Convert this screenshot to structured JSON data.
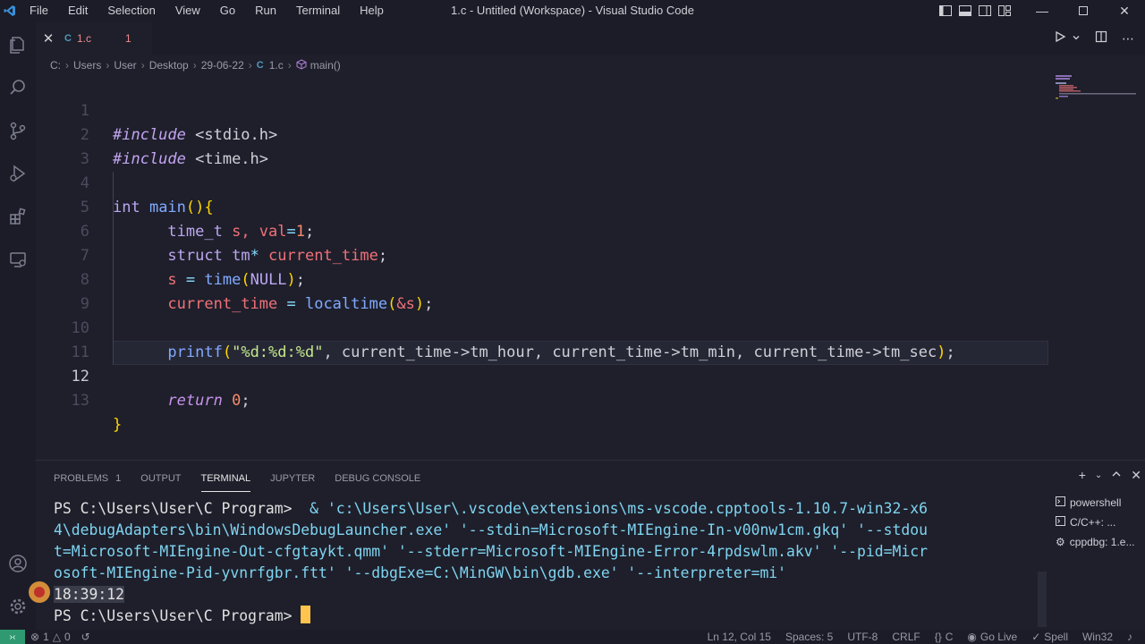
{
  "titlebar": {
    "menu": [
      "File",
      "Edit",
      "Selection",
      "View",
      "Go",
      "Run",
      "Terminal",
      "Help"
    ],
    "title": "1.c - Untitled (Workspace) - Visual Studio Code"
  },
  "tab": {
    "close": "✕",
    "lang": "C",
    "filename": "1.c",
    "problem_count": "1"
  },
  "breadcrumb": [
    "C:",
    "Users",
    "User",
    "Desktop",
    "29-06-22"
  ],
  "breadcrumb_file": {
    "lang": "C",
    "name": "1.c"
  },
  "breadcrumb_symbol": "main()",
  "code": {
    "line_numbers": [
      "1",
      "2",
      "3",
      "4",
      "5",
      "6",
      "7",
      "8",
      "9",
      "10",
      "11",
      "12",
      "13"
    ],
    "active_line": "12",
    "lines": {
      "l1": {
        "pp": "#include",
        "rest": " <stdio.h>"
      },
      "l2": {
        "pp": "#include",
        "rest": " <time.h>"
      },
      "l4": {
        "type": "int",
        "fn": " main",
        "paren": "()",
        "brace": "{"
      },
      "l5": {
        "type": "time_t",
        "rest": " s, ",
        "id": "val",
        "op": "=",
        "num": "1",
        "end": ";"
      },
      "l6": {
        "type": "struct",
        "ty2": " tm",
        "op": "*",
        "id": " current_time",
        "end": ";"
      },
      "l7": {
        "id": "s",
        "op": " = ",
        "fn": "time",
        "p1": "(",
        "arg": "NULL",
        "p2": ")",
        "end": ";"
      },
      "l8": {
        "id": "current_time",
        "op": " = ",
        "fn": "localtime",
        "p1": "(",
        "arg": "&s",
        "p2": ")",
        "end": ";"
      },
      "l10": {
        "fn": "printf",
        "p1": "(",
        "str": "\"%d:%d:%d\"",
        "rest": ", current_time->tm_hour, current_time->tm_min, current_time->tm_sec",
        "p2": ")",
        "end": ";"
      },
      "l12": {
        "kw": "return",
        "num": " 0",
        "end": ";"
      },
      "l13": {
        "brace": "}"
      }
    }
  },
  "panel": {
    "tabs": [
      {
        "label": "PROBLEMS",
        "badge": "1"
      },
      {
        "label": "OUTPUT"
      },
      {
        "label": "TERMINAL"
      },
      {
        "label": "JUPYTER"
      },
      {
        "label": "DEBUG CONSOLE"
      }
    ],
    "active_tab": "TERMINAL",
    "terminals": [
      "powershell",
      "C/C++: ...",
      "cppdbg: 1.e..."
    ]
  },
  "terminal": {
    "prompt": "PS C:\\Users\\User\\C Program>",
    "command_lines": [
      "  & 'c:\\Users\\User\\.vscode\\extensions\\ms-vscode.cpptools-1.10.7-win32-x6",
      "4\\debugAdapters\\bin\\WindowsDebugLauncher.exe' '--stdin=Microsoft-MIEngine-In-v00nw1cm.gkq' '--stdou",
      "t=Microsoft-MIEngine-Out-cfgtaykt.qmm' '--stderr=Microsoft-MIEngine-Error-4rpdswlm.akv' '--pid=Micr",
      "osoft-MIEngine-Pid-yvnrfgbr.ftt' '--dbgExe=C:\\MinGW\\bin\\gdb.exe' '--interpreter=mi'"
    ],
    "output": "18:39:12",
    "final_prompt": "PS C:\\Users\\User\\C Program> "
  },
  "statusbar": {
    "errors": "1",
    "warnings": "0",
    "position": "Ln 12, Col 15",
    "spaces": "Spaces: 5",
    "encoding": "UTF-8",
    "eol": "CRLF",
    "language": "C",
    "golive": "Go Live",
    "spell": "Spell",
    "platform": "Win32"
  },
  "colors": {
    "background": "#1e1f2b",
    "accent": "#2f9a72",
    "cursor": "#ffc44d"
  }
}
